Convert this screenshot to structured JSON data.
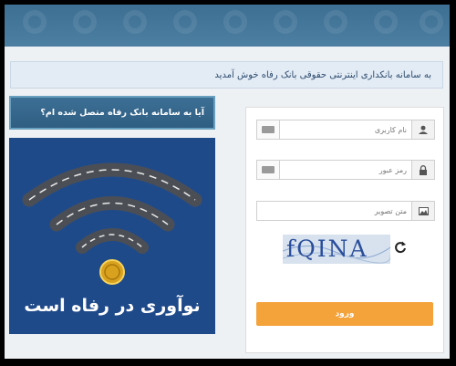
{
  "welcome": {
    "text": "به سامانه بانکداری اینترنتی حقوقی بانک رفاه خوش آمدید"
  },
  "side": {
    "question_label": "آیا به سامانه بانک رفاه متصل شده ام؟",
    "promo_text": "نوآوری در رفاه است",
    "promo_icons": [
      "wifi-road-icon",
      "gold-coin-icon"
    ]
  },
  "login": {
    "username_placeholder": "نام کاربری",
    "password_placeholder": "رمز عبور",
    "captcha_placeholder": "متن تصویر",
    "captcha_text": "fQINA",
    "submit_label": "ورود",
    "icons": [
      "user-icon",
      "lock-icon",
      "image-icon",
      "keyboard-icon",
      "refresh-icon"
    ]
  },
  "colors": {
    "header": "#3d6f93",
    "accent_button": "#f4a23a",
    "promo_bg": "#1f4a8a"
  }
}
